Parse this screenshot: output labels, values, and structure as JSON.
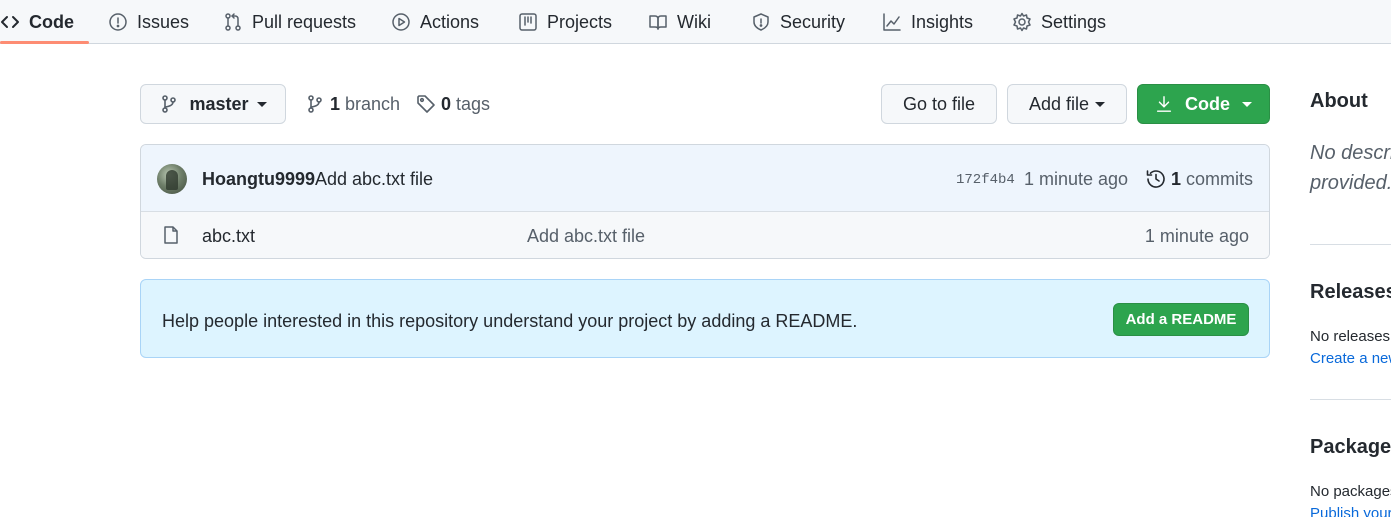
{
  "nav": {
    "tabs": [
      {
        "label": "Code",
        "icon": "code-icon",
        "selected": true
      },
      {
        "label": "Issues",
        "icon": "issue-icon"
      },
      {
        "label": "Pull requests",
        "icon": "pull-request-icon"
      },
      {
        "label": "Actions",
        "icon": "play-icon"
      },
      {
        "label": "Projects",
        "icon": "project-icon"
      },
      {
        "label": "Wiki",
        "icon": "book-icon"
      },
      {
        "label": "Security",
        "icon": "shield-icon"
      },
      {
        "label": "Insights",
        "icon": "graph-icon"
      },
      {
        "label": "Settings",
        "icon": "gear-icon"
      }
    ],
    "accent_color": "#fd8c73"
  },
  "toolbar": {
    "branch_button": "master",
    "branch_count": "1",
    "branch_label": "branch",
    "tag_count": "0",
    "tag_label": "tags",
    "go_to_file": "Go to file",
    "add_file": "Add file",
    "code_button": "Code",
    "code_button_color": "#2da44e"
  },
  "latest_commit": {
    "author": "Hoangtu9999",
    "message": "Add abc.txt file",
    "sha": "172f4b4",
    "time": "1 minute ago",
    "commit_count": "1",
    "commit_label": "commits"
  },
  "files": [
    {
      "name": "abc.txt",
      "message": "Add abc.txt file",
      "time": "1 minute ago",
      "icon": "file-icon"
    }
  ],
  "readme": {
    "text": "Help people interested in this repository understand your project by adding a README.",
    "button": "Add a README"
  },
  "sidebar": {
    "about_heading": "About",
    "about_desc_line1": "No descri",
    "about_desc_line2": "provided.",
    "releases_heading": "Releases",
    "releases_text": "No releases",
    "releases_link": "Create a new",
    "packages_heading": "Packages",
    "packages_text": "No packages",
    "packages_link": "Publish your"
  }
}
